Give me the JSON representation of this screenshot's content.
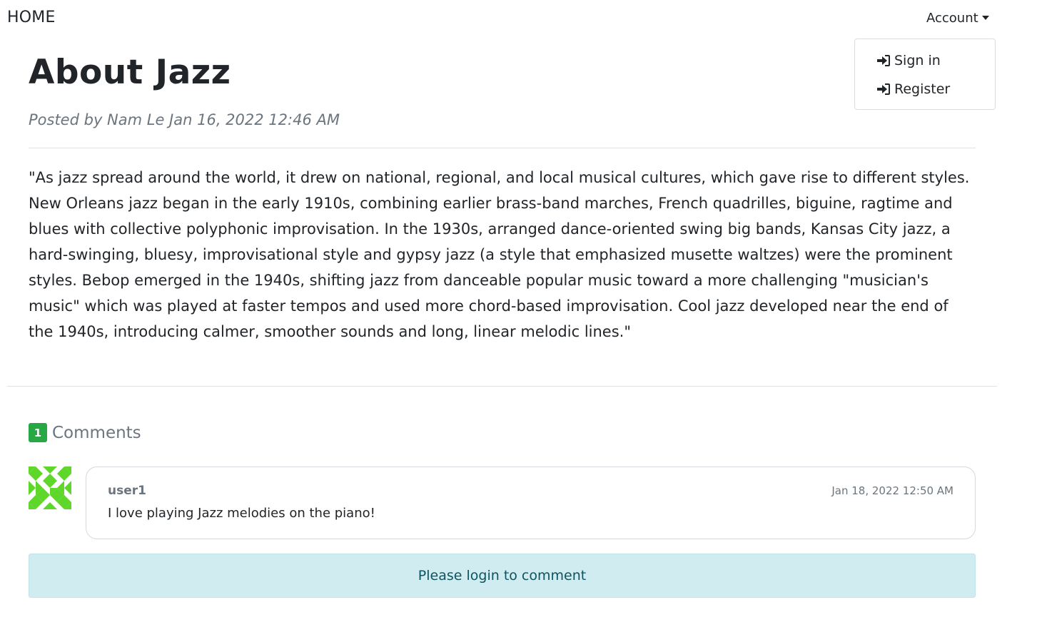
{
  "nav": {
    "home_label": "HOME",
    "account_label": "Account",
    "account_menu": [
      {
        "label": "Sign in",
        "icon": "sign-in-icon"
      },
      {
        "label": "Register",
        "icon": "sign-in-icon"
      }
    ]
  },
  "post": {
    "title": "About Jazz",
    "byline": "Posted by Nam Le Jan 16, 2022 12:46 AM",
    "body": "\"As jazz spread around the world, it drew on national, regional, and local musical cultures, which gave rise to different styles. New Orleans jazz began in the early 1910s, combining earlier brass-band marches, French quadrilles, biguine, ragtime and blues with collective polyphonic improvisation. In the 1930s, arranged dance-oriented swing big bands, Kansas City jazz, a hard-swinging, bluesy, improvisational style and gypsy jazz (a style that emphasized musette waltzes) were the prominent styles. Bebop emerged in the 1940s, shifting jazz from danceable popular music toward a more challenging \"musician's music\" which was played at faster tempos and used more chord-based improvisation. Cool jazz developed near the end of the 1940s, introducing calmer, smoother sounds and long, linear melodic lines.\""
  },
  "comments": {
    "count": "1",
    "label": "Comments",
    "badge_color": "#28a745",
    "items": [
      {
        "user": "user1",
        "date": "Jan 18, 2022 12:50 AM",
        "text": "I love playing Jazz melodies on the piano!"
      }
    ]
  },
  "alert": {
    "message": "Please login to comment"
  },
  "colors": {
    "alert_bg": "#d1ecf1",
    "alert_text": "#0c5460",
    "avatar_green": "#5ed62a"
  }
}
